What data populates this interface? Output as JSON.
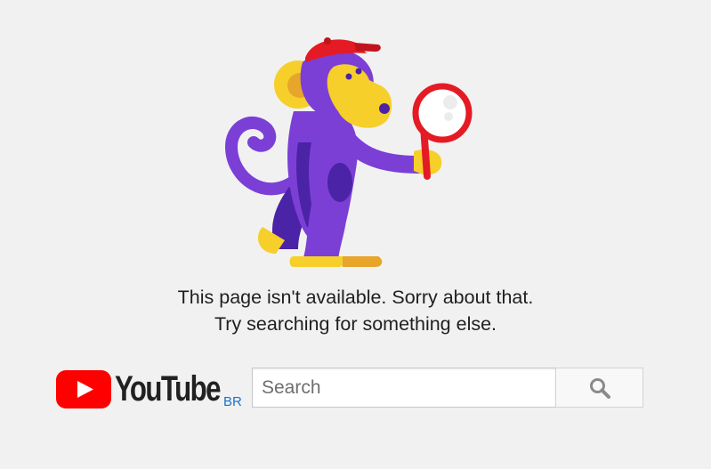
{
  "page": {
    "message_line_1": "This page isn't available. Sorry about that.",
    "message_line_2": "Try searching for something else."
  },
  "logo": {
    "wordmark": "YouTube",
    "country_code": "BR",
    "icon": "youtube-play-icon",
    "brand_color": "#ff0000"
  },
  "search": {
    "placeholder": "Search",
    "value": "",
    "button_icon": "search-icon"
  },
  "illustration": {
    "icon": "monkey-with-magnifier-illustration"
  }
}
